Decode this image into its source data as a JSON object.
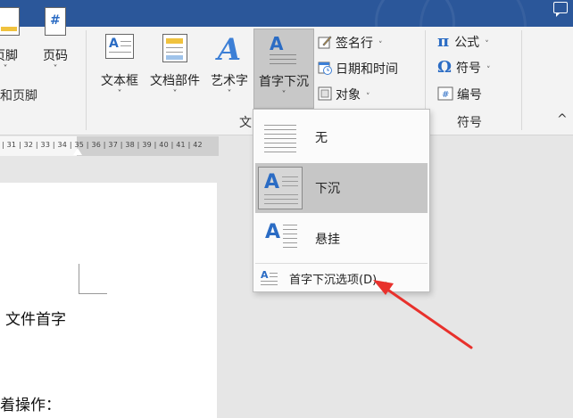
{
  "ribbon": {
    "header_footer_partial": "页脚",
    "page_number": "页码",
    "text_box": "文本框",
    "quick_parts": "文档部件",
    "word_art": "艺术字",
    "drop_cap": "首字下沉",
    "signature_line": "签名行",
    "date_time": "日期和时间",
    "object": "对象",
    "equation": "公式",
    "symbol": "符号",
    "number": "编号",
    "group_header_footer": "和页脚",
    "group_text": "文",
    "group_symbols": "符号",
    "dropdown_arrow": "˅",
    "collapse_ribbon": "^"
  },
  "ruler": {
    "numbers": "| 31 | 32 | 33 | 34 | 35 | 36 | 37 | 38 | 39 | 40 | 41 | 42"
  },
  "document": {
    "line1": "文件首字",
    "line2": "着操作："
  },
  "drop_cap_menu": {
    "items": [
      {
        "label": "无"
      },
      {
        "label": "下沉",
        "selected": true
      },
      {
        "label": "悬挂"
      }
    ],
    "options": "首字下沉选项(D)..."
  },
  "icons": {
    "letter_a": "A",
    "hash": "#",
    "pi": "π",
    "omega": "Ω"
  },
  "colors": {
    "title_bar": "#2b579a",
    "accent_blue": "#2b6cc4",
    "arrow_red": "#e8312c",
    "selected_item": "#c6c6c6"
  }
}
